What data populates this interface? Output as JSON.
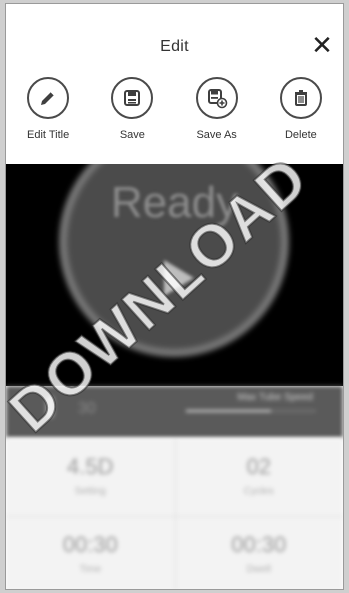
{
  "header": {
    "title": "Edit",
    "close_glyph": "✕"
  },
  "actions": [
    {
      "label": "Edit Title",
      "icon": "pencil-icon"
    },
    {
      "label": "Save",
      "icon": "save-icon"
    },
    {
      "label": "Save As",
      "icon": "save-as-icon"
    },
    {
      "label": "Delete",
      "icon": "trash-icon"
    }
  ],
  "preview": {
    "status_text": "Ready",
    "status": {
      "temp": "30",
      "max_tube_label": "Max Tube Speed",
      "max_tube_level": 0.65
    },
    "cells": [
      {
        "value": "4.5D",
        "name": "Setting"
      },
      {
        "value": "02",
        "name": "Cycles"
      },
      {
        "value": "00:30",
        "name": "Time"
      },
      {
        "value": "00:30",
        "name": "Dwell"
      }
    ]
  },
  "watermark": "DOWNLOAD"
}
